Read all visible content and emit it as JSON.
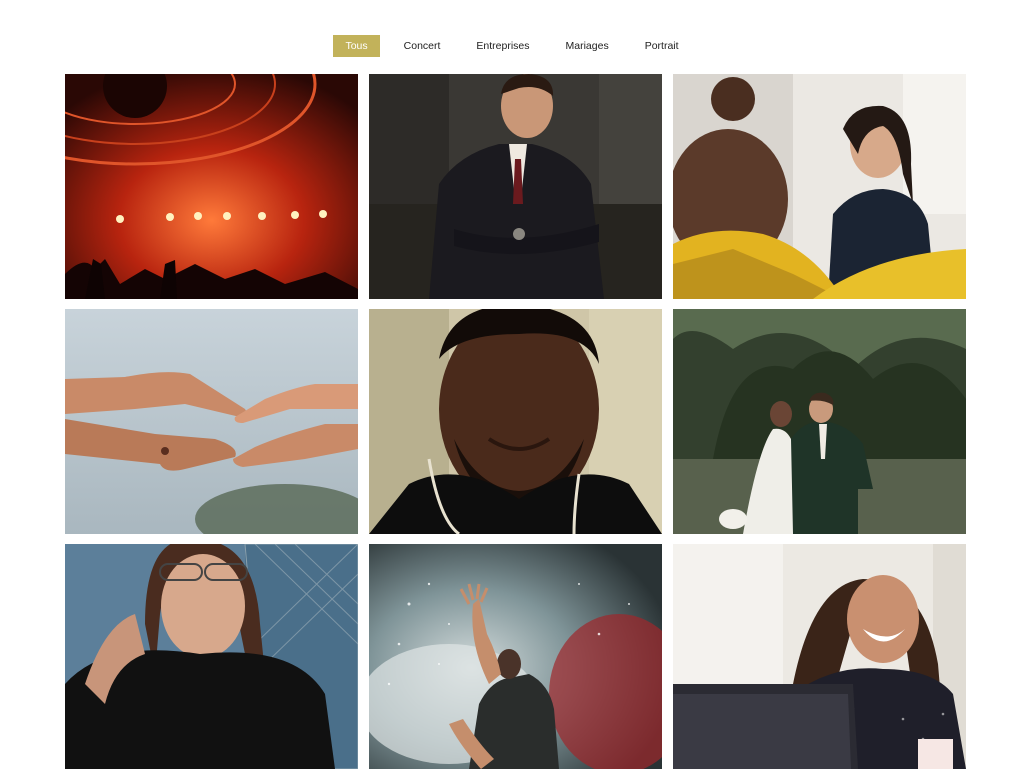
{
  "filters": [
    {
      "label": "Tous",
      "active": true
    },
    {
      "label": "Concert",
      "active": false
    },
    {
      "label": "Entreprises",
      "active": false
    },
    {
      "label": "Mariages",
      "active": false
    },
    {
      "label": "Portrait",
      "active": false
    }
  ],
  "gallery": {
    "photos": [
      {
        "subject": "concert-stage",
        "accent": "#c0391b"
      },
      {
        "subject": "businessman-in-suit",
        "accent": "#1f1f24"
      },
      {
        "subject": "business-meeting",
        "accent": "#e2b320"
      },
      {
        "subject": "reaching-hands",
        "accent": "#b8c6cf"
      },
      {
        "subject": "man-portrait",
        "accent": "#3a2418"
      },
      {
        "subject": "wedding-couple",
        "accent": "#2e3d2a"
      },
      {
        "subject": "woman-with-glasses",
        "accent": "#1a1a1a"
      },
      {
        "subject": "singer-in-smoke",
        "accent": "#8fa3a6"
      },
      {
        "subject": "woman-laughing-laptop",
        "accent": "#2b2b33"
      }
    ]
  }
}
